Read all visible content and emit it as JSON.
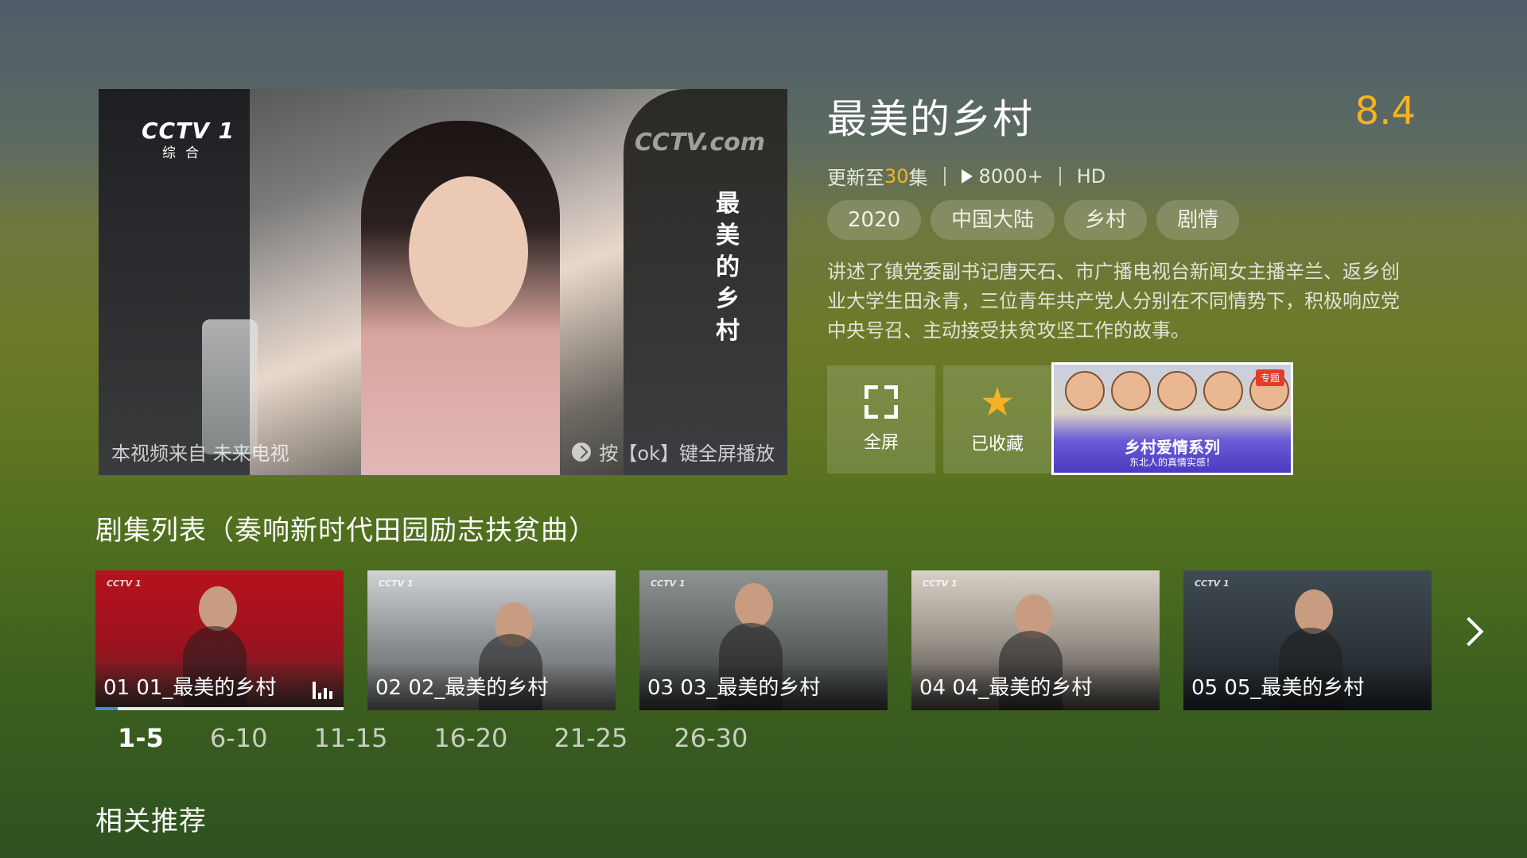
{
  "video": {
    "channel_logo": "CCTV 1",
    "channel_sub": "综合",
    "watermark": "CCTV.com",
    "overlay_title": "最美的乡村",
    "source_text": "本视频来自 未来电视",
    "fullscreen_hint": "按【ok】键全屏播放"
  },
  "show": {
    "title": "最美的乡村",
    "rating": "8.4",
    "update_prefix": "更新至",
    "update_count": "30",
    "update_suffix": "集",
    "plays": "8000+",
    "quality": "HD",
    "tags": [
      "2020",
      "中国大陆",
      "乡村",
      "剧情"
    ],
    "description": "讲述了镇党委副书记唐天石、市广播电视台新闻女主播辛兰、返乡创业大学生田永青，三位青年共产党人分别在不同情势下，积极响应党中央号召、主动接受扶贫攻坚工作的故事。"
  },
  "actions": {
    "fullscreen_label": "全屏",
    "favorite_label": "已收藏"
  },
  "promo": {
    "badge": "专题",
    "title": "乡村爱情系列",
    "subtitle": "东北人的真情实感！"
  },
  "episodes": {
    "heading": "剧集列表（奏响新时代田园励志扶贫曲）",
    "items": [
      {
        "label": "01 01_最美的乡村"
      },
      {
        "label": "02 02_最美的乡村"
      },
      {
        "label": "03 03_最美的乡村"
      },
      {
        "label": "04 04_最美的乡村"
      },
      {
        "label": "05 05_最美的乡村"
      }
    ],
    "ranges": [
      "1-5",
      "6-10",
      "11-15",
      "16-20",
      "21-25",
      "26-30"
    ],
    "active_range": "1-5",
    "thumb_logo": "CCTV 1"
  },
  "related": {
    "heading": "相关推荐"
  },
  "colors": {
    "accent": "#f5b323",
    "progress": "#3b8ed8"
  }
}
